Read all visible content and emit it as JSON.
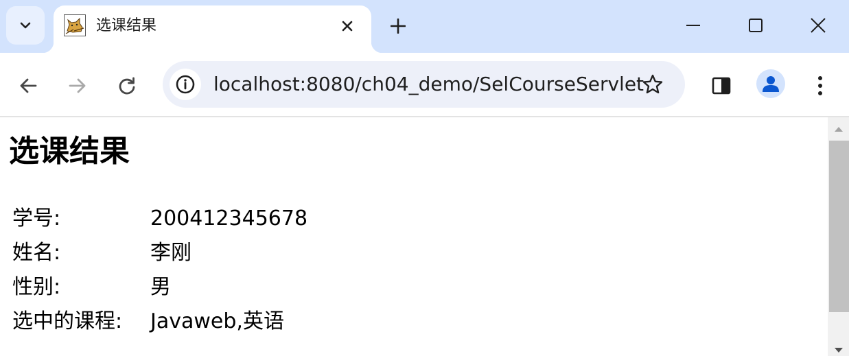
{
  "browser": {
    "tab": {
      "title": "选课结果",
      "favicon": "tomcat-cat-icon"
    },
    "url": "localhost:8080/ch04_demo/SelCourseServlet",
    "accent_color": "#d3e3fd",
    "icons": {
      "tab_search": "chevron-down-icon",
      "tab_close": "close-icon",
      "new_tab": "plus-icon",
      "minimize": "minimize-icon",
      "maximize": "maximize-icon",
      "close_window": "close-icon",
      "back": "arrow-left-icon",
      "forward": "arrow-right-icon",
      "reload": "reload-icon",
      "site_info": "info-icon",
      "bookmark": "star-icon",
      "side_panel": "side-panel-icon",
      "profile": "person-icon",
      "menu": "kebab-menu-icon"
    }
  },
  "page": {
    "heading": "选课结果",
    "rows": [
      {
        "label": "学号:",
        "value": "200412345678"
      },
      {
        "label": "姓名:",
        "value": "李刚"
      },
      {
        "label": "性别:",
        "value": "男"
      },
      {
        "label": "选中的课程:",
        "value": "Javaweb,英语"
      }
    ]
  }
}
